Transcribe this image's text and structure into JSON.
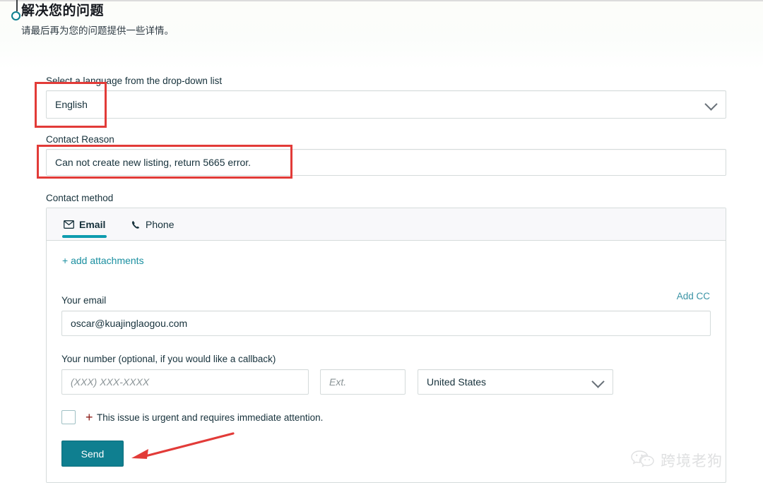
{
  "header": {
    "title": "解决您的问题",
    "subtitle": "请最后再为您的问题提供一些详情。",
    "stepper_icon": "step-circle-icon"
  },
  "form": {
    "language": {
      "label": "Select a language from the drop-down list",
      "value": "English",
      "chevron_icon": "chevron-down-icon"
    },
    "contact_reason": {
      "label": "Contact Reason",
      "value": "Can not create new listing, return 5665 error."
    },
    "contact_method": {
      "label": "Contact method",
      "tabs": [
        {
          "label": "Email",
          "icon": "envelope-icon",
          "active": true
        },
        {
          "label": "Phone",
          "icon": "phone-icon",
          "active": false
        }
      ],
      "attachments_link": "+ add attachments",
      "email": {
        "label": "Your email",
        "value": "oscar@kuajinglaogou.com",
        "add_cc_label": "Add CC"
      },
      "phone": {
        "label": "Your number (optional, if you would like a callback)",
        "number_placeholder": "(XXX) XXX-XXXX",
        "ext_placeholder": "Ext.",
        "country_value": "United States",
        "chevron_icon": "chevron-down-icon"
      },
      "urgent": {
        "checked": false,
        "plus_glyph": "+",
        "label": "This issue is urgent and requires immediate attention."
      },
      "send_label": "Send"
    }
  },
  "annotations": {
    "box_language": "highlight-language-select",
    "box_reason": "highlight-contact-reason",
    "arrow_send": "arrow-pointing-to-send"
  },
  "watermark": {
    "icon": "wechat-icon",
    "text": "跨境老狗"
  },
  "colors": {
    "accent_teal": "#0f7f90",
    "tab_underline": "#0e9cae",
    "link": "#1a8fa0",
    "annotation_red": "#e23b38",
    "urgent_plus_red": "#8b1a16",
    "text_dark": "#16313b",
    "border_gray": "#d5dbdb"
  }
}
